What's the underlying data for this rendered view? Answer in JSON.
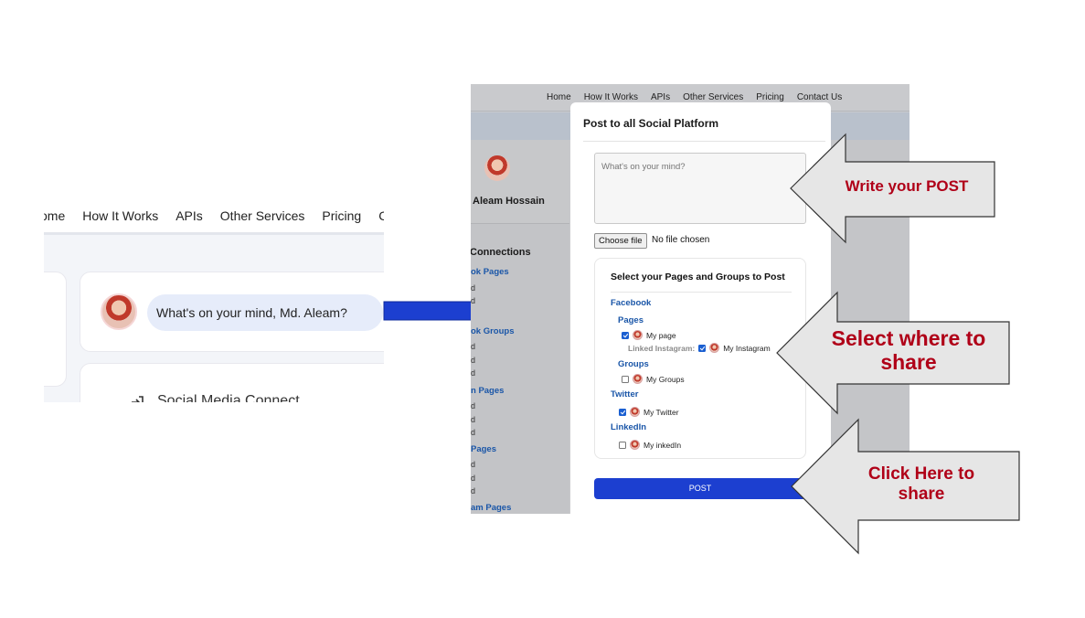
{
  "left": {
    "nav": [
      "ome",
      "How It Works",
      "APIs",
      "Other Services",
      "Pricing",
      "C"
    ],
    "post_prompt": "What's on your mind, Md. Aleam?",
    "social_connect": "Social Media Connect"
  },
  "right": {
    "nav": [
      "Home",
      "How It Works",
      "APIs",
      "Other Services",
      "Pricing",
      "Contact Us"
    ],
    "profile_name": "Aleam Hossain",
    "connections_title": "Connections",
    "side_links": [
      "ok Pages",
      "ok Groups",
      "n Pages",
      "Pages",
      "am Pages"
    ],
    "side_d": "d"
  },
  "modal": {
    "title": "Post to all Social Platform",
    "textarea_placeholder": "What's on your mind?",
    "file_button": "Choose file",
    "file_status": "No file chosen",
    "select_title": "Select your Pages and Groups to Post",
    "facebook": "Facebook",
    "pages": "Pages",
    "my_page": "My page",
    "linked_instagram": "Linked Instagram:",
    "my_instagram": "My Instagram",
    "groups": "Groups",
    "my_groups": "My Groups",
    "twitter": "Twitter",
    "my_twitter": "My Twitter",
    "linkedin": "LinkedIn",
    "my_linkedin": "My inkedIn",
    "post_button": "POST",
    "checked": {
      "my_page": true,
      "my_instagram": true,
      "my_groups": false,
      "my_twitter": true,
      "my_linkedin": false
    }
  },
  "callouts": {
    "write": "Write your POST",
    "select": "Select where to share",
    "click": "Click Here to share"
  },
  "colors": {
    "accent_blue": "#1c3fd0",
    "callout_text": "#b00018",
    "link_blue": "#1a56a8"
  }
}
